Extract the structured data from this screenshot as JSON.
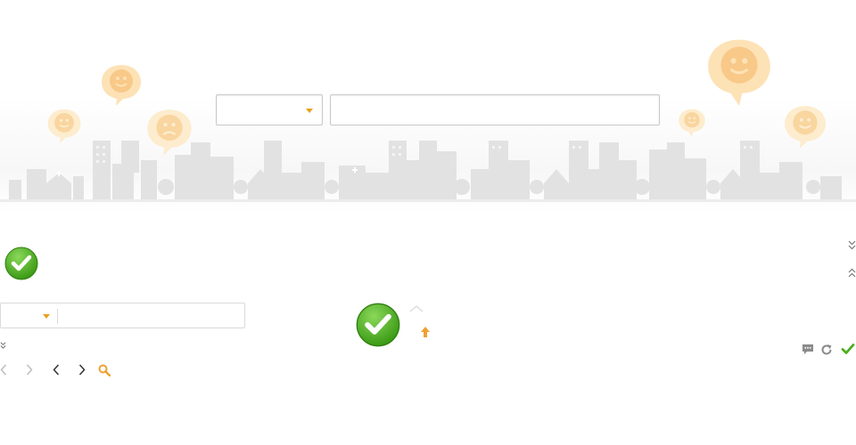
{
  "search_bar": {
    "category_select_value": "",
    "query_value": "",
    "query_placeholder": ""
  },
  "mini_search": {
    "category_select_value": "",
    "query_value": "",
    "query_placeholder": ""
  },
  "icons": {
    "bubble_smile": "smile-bubble-icon",
    "bubble_sad": "sad-bubble-icon",
    "check_large": "check-circle-icon",
    "check_small": "check-icon",
    "arrow_up": "arrow-up-icon",
    "chevron_up": "chevron-up-icon",
    "double_down": "double-chevron-down-icon",
    "double_up": "double-chevron-up-icon",
    "comment": "comment-icon",
    "refresh": "refresh-icon",
    "prev": "chevron-left-icon",
    "next": "chevron-right-icon",
    "search": "search-icon"
  },
  "colors": {
    "bubble_light": "#fde7c2",
    "bubble_face": "#f6c98a",
    "accent_orange": "#f0a030",
    "check_green": "#4cae1f",
    "skyline_gray": "#dcdcdc",
    "icon_gray": "#8a8a8a"
  }
}
